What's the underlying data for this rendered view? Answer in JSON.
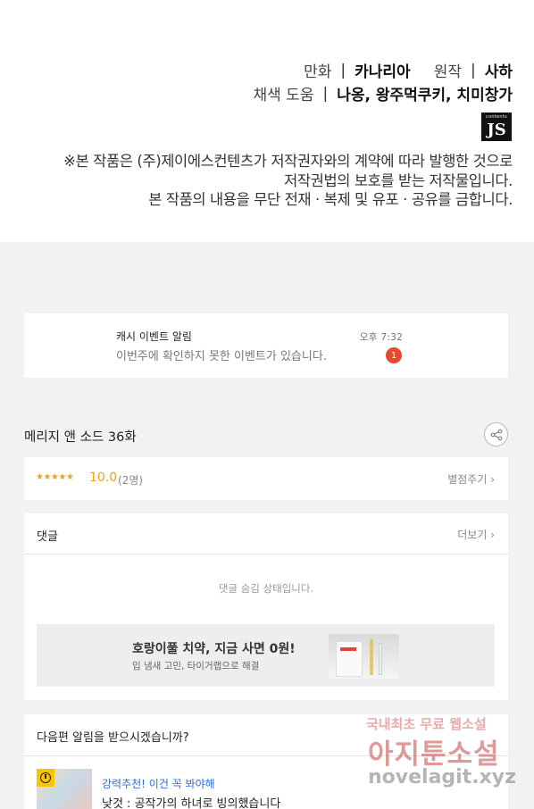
{
  "credits": {
    "line1": {
      "label1": "만화",
      "value1": "카나리아",
      "label2": "원작",
      "value2": "사하"
    },
    "line2": {
      "label": "채색 도움",
      "value": "나옹, 왕주먹쿠키, 치미창가"
    },
    "separator": "|",
    "publisher_logo_small": "contents",
    "publisher_logo_big": "JS",
    "notice": [
      "※본 작품은 (주)제이에스컨텐츠가 저작권자와의 계약에 따라 발행한 것으로",
      "저작권법의 보호를 받는 저작물입니다.",
      "본 작품의 내용을 무단 전재 · 복제 및 유포 · 공유를 금합니다."
    ]
  },
  "cash_event": {
    "title": "캐시 이벤트 알림",
    "description": "이번주에 확인하지 못한 이벤트가 있습니다.",
    "time": "오후 7:32",
    "badge_count": "1"
  },
  "episode": {
    "title": "메리지 앤 소드 36화",
    "share_icon": "share-icon"
  },
  "rating": {
    "stars": "★★★★★",
    "score": "10.0",
    "voters": "(2명)",
    "rate_link": "별점주기 ›"
  },
  "comments": {
    "title": "댓글",
    "more_link": "더보기 ›",
    "hidden_notice": "댓글 숨김 상태입니다."
  },
  "ad": {
    "title": "호랑이풀 치약, 지금 사면 0원!",
    "subtitle": "입 냄새 고민, 타이거랩으로 해결"
  },
  "next_alert": {
    "question": "다음편 알림을 받으시겠습니까?",
    "rec_label": "강력추천! 이건 꼭 봐야해",
    "rec_title": "낮것 : 공작가의 하녀로 빙의했습니다"
  },
  "watermark": {
    "line1": "국내최초 무료 웹소설",
    "line2": "아지툰소설",
    "line3": "novelagit.xyz"
  },
  "colors": {
    "accent_red": "#e8482e",
    "star_orange": "#f0a020",
    "link_blue": "#2a6fd6"
  }
}
